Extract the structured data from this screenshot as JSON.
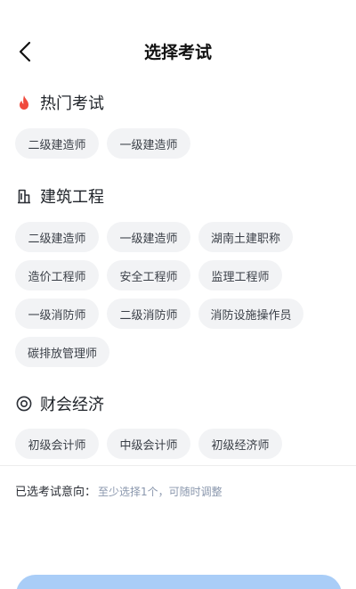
{
  "nav": {
    "title": "选择考试"
  },
  "sections": {
    "hot": {
      "title": "热门考试",
      "items": [
        "二级建造师",
        "一级建造师"
      ]
    },
    "construction": {
      "title": "建筑工程",
      "items": [
        "二级建造师",
        "一级建造师",
        "湖南土建职称",
        "造价工程师",
        "安全工程师",
        "监理工程师",
        "一级消防师",
        "二级消防师",
        "消防设施操作员",
        "碳排放管理师"
      ]
    },
    "finance": {
      "title": "财会经济",
      "items": [
        "初级会计师",
        "中级会计师",
        "初级经济师"
      ]
    }
  },
  "selection": {
    "label": "已选考试意向：",
    "hint": "至少选择1个，可随时调整"
  },
  "colors": {
    "accent": "#a9cdf7",
    "hot_icon": "#f04a3c",
    "chip_bg": "#f2f3f5"
  }
}
